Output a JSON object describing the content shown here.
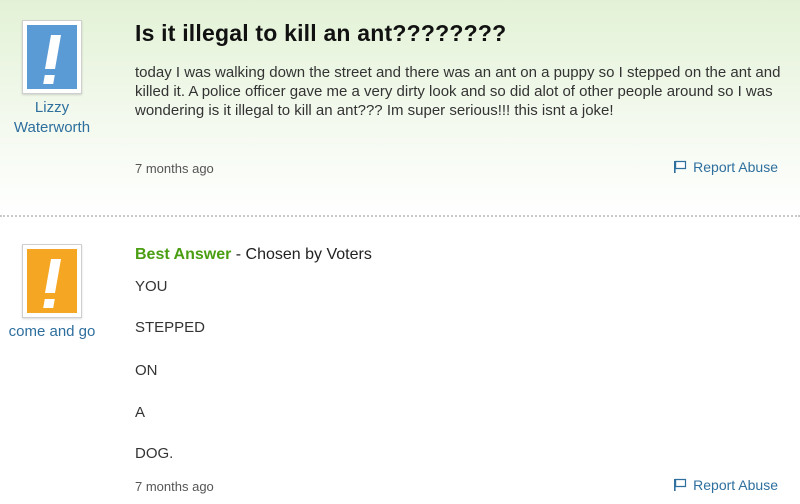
{
  "question": {
    "user": "Lizzy Waterworth",
    "title": "Is it illegal to kill an ant????????",
    "body": "today I was walking down the street and there was an ant on a puppy so I stepped on the ant and killed it. A police officer gave me a very dirty look and so did alot of other people around so I was wondering is it illegal to kill an ant??? Im super serious!!! this isnt a joke!",
    "time": "7 months ago",
    "report_label": "Report Abuse",
    "avatar_color": "#5b9bd5"
  },
  "answer": {
    "user": "come and go",
    "best_label": "Best Answer",
    "chosen_text": " - Chosen by Voters",
    "lines": [
      "YOU",
      "STEPPED",
      "ON",
      "A",
      "DOG."
    ],
    "time": "7 months ago",
    "report_label": "Report Abuse",
    "avatar_color": "#f5a623"
  },
  "colors": {
    "link": "#2e6f9e",
    "best_answer": "#4a9e12"
  }
}
